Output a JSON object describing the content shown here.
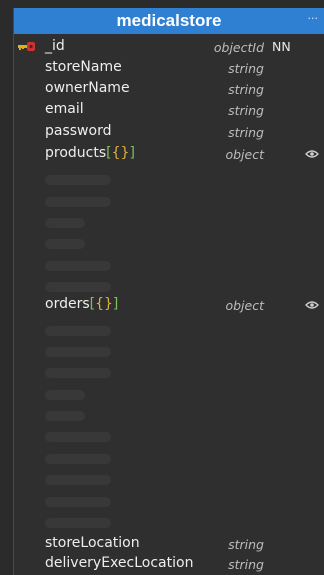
{
  "entity": {
    "title": "medicalstore",
    "menu_glyph": "···",
    "fields": [
      {
        "name": "_id",
        "type": "objectId",
        "flag": "NN"
      },
      {
        "name": "storeName",
        "type": "string"
      },
      {
        "name": "ownerName",
        "type": "string"
      },
      {
        "name": "email",
        "type": "string"
      },
      {
        "name": "password",
        "type": "string"
      },
      {
        "name": "products",
        "brackets": [
          "[",
          "{}",
          "]"
        ],
        "type": "object"
      },
      {
        "name": "orders",
        "brackets": [
          "[",
          "{}",
          "]"
        ],
        "type": "object"
      },
      {
        "name": "storeLocation",
        "type": "string"
      },
      {
        "name": "deliveryExecLocation",
        "type": "string"
      }
    ]
  },
  "colors": {
    "header": "#2f7fd3",
    "body": "#2f2f2f",
    "placeholder": "#383838",
    "bracket_square": "#7ec25a",
    "bracket_curly": "#e0b040",
    "key": "#d8b020"
  },
  "icons": {
    "primary_key": "key-icon",
    "visibility": "eye-icon",
    "menu": "more-icon"
  }
}
